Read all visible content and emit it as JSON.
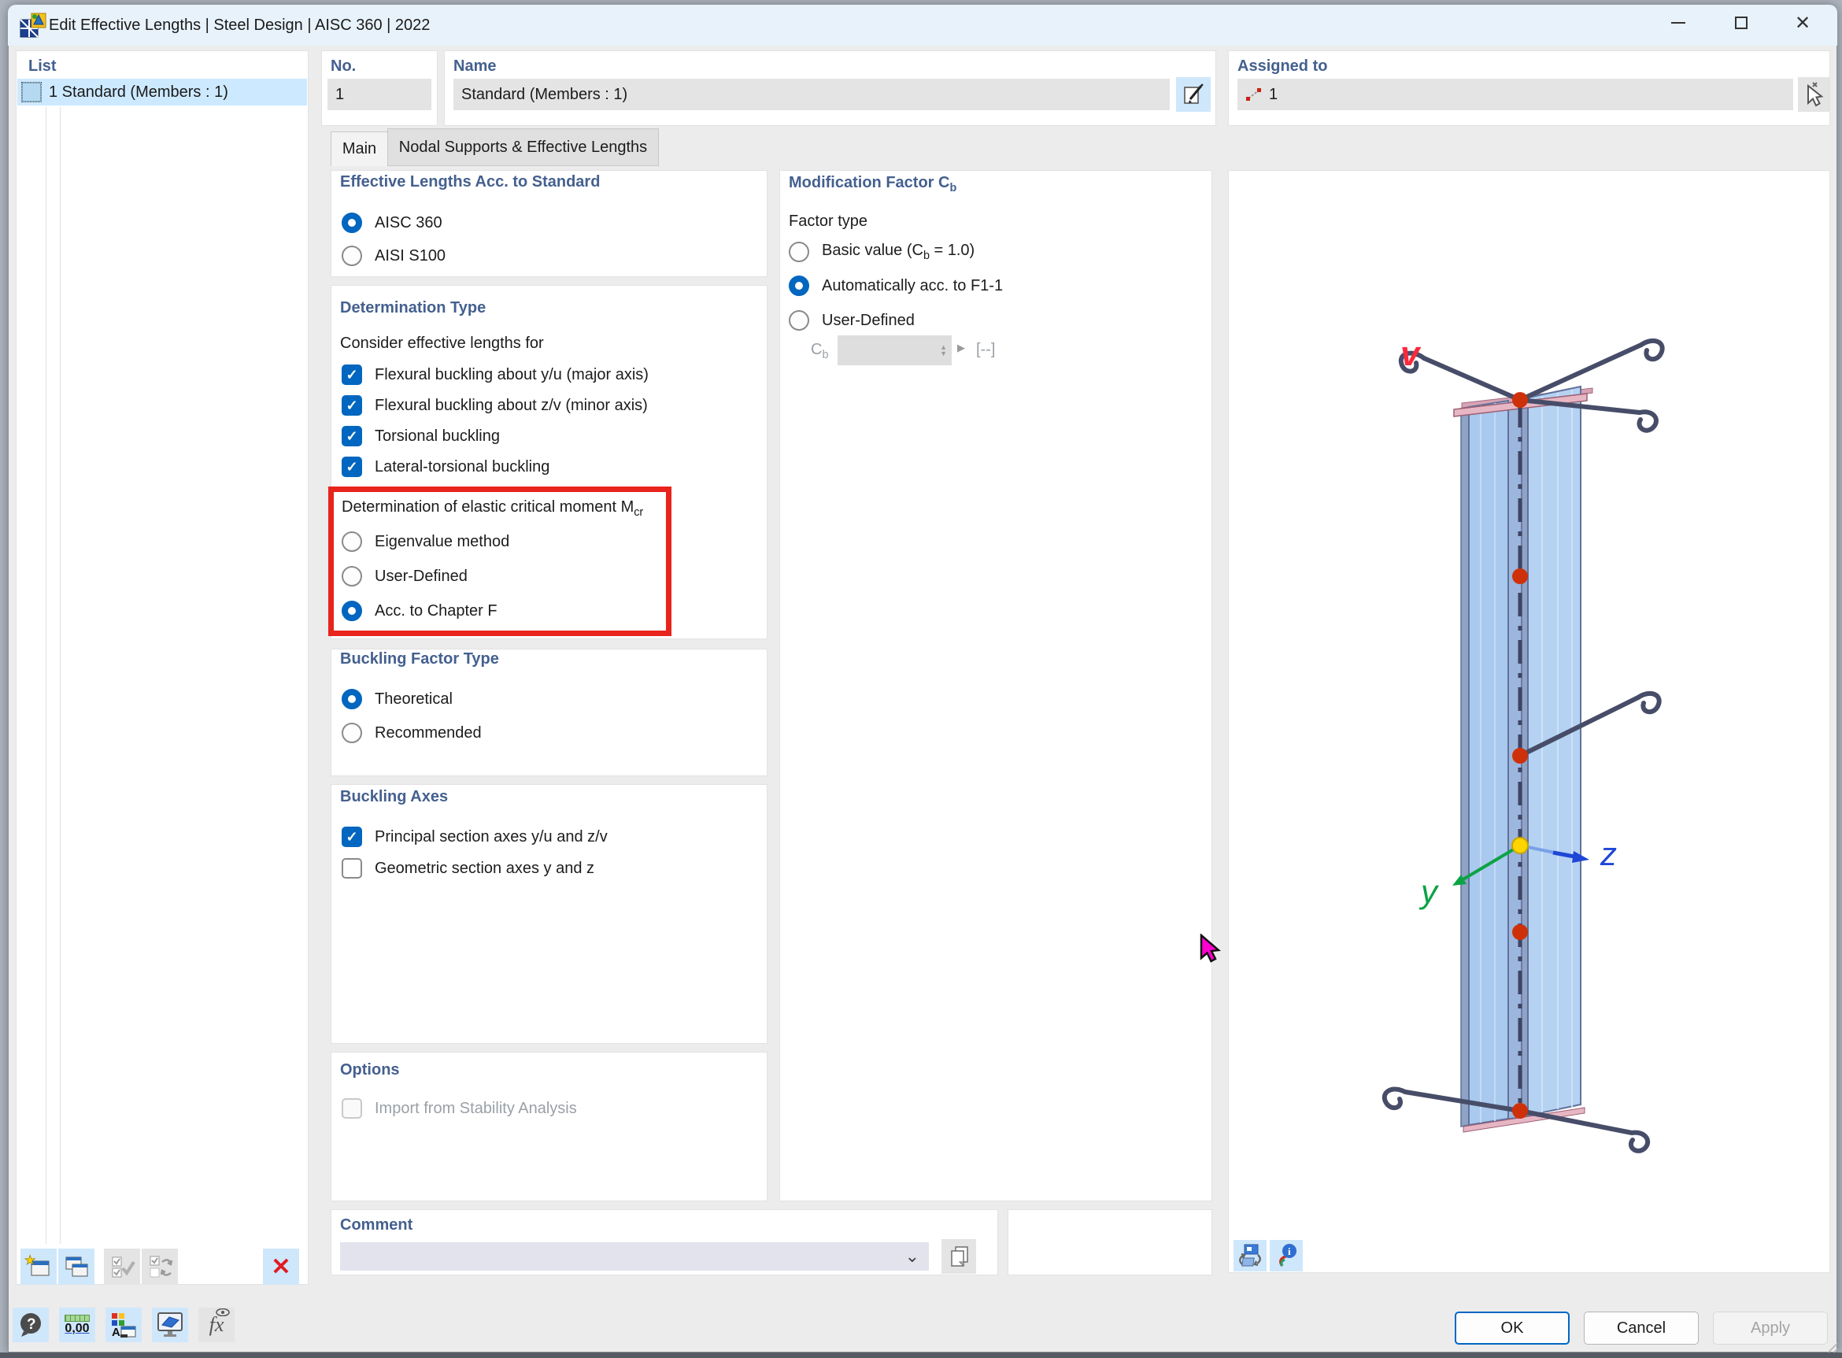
{
  "window": {
    "title": "Edit Effective Lengths | Steel Design | AISC 360 | 2022"
  },
  "list_panel": {
    "header": "List",
    "item": "1 Standard (Members : 1)"
  },
  "fields": {
    "no_label": "No.",
    "no_value": "1",
    "name_label": "Name",
    "name_value": "Standard (Members : 1)",
    "assigned_label": "Assigned to",
    "assigned_value": "1"
  },
  "tabs": {
    "main": "Main",
    "nodal": "Nodal Supports & Effective Lengths"
  },
  "std": {
    "title": "Effective Lengths Acc. to Standard",
    "options": [
      "AISC 360",
      "AISI S100"
    ],
    "selected": "AISC 360"
  },
  "det": {
    "title": "Determination Type",
    "consider": "Consider effective lengths for",
    "checks": [
      {
        "label": "Flexural buckling about y/u (major axis)",
        "checked": true
      },
      {
        "label": "Flexural buckling about z/v (minor axis)",
        "checked": true
      },
      {
        "label": "Torsional buckling",
        "checked": true
      },
      {
        "label": "Lateral-torsional buckling",
        "checked": true
      }
    ]
  },
  "mcr": {
    "label_pre": "Determination of elastic critical moment M",
    "label_sub": "cr",
    "options": [
      "Eigenvalue method",
      "User-Defined",
      "Acc. to Chapter F"
    ],
    "selected": "Acc. to Chapter F"
  },
  "bft": {
    "title": "Buckling Factor Type",
    "options": [
      "Theoretical",
      "Recommended"
    ],
    "selected": "Theoretical"
  },
  "axes": {
    "title": "Buckling Axes",
    "checks": [
      {
        "label": "Principal section axes y/u and z/v",
        "checked": true
      },
      {
        "label": "Geometric section axes y and z",
        "checked": false
      }
    ]
  },
  "opts": {
    "title": "Options",
    "check": "Import from Stability Analysis"
  },
  "cb": {
    "title_pre": "Modification Factor C",
    "title_sub": "b",
    "factor_label": "Factor type",
    "r1_pre": "Basic value (C",
    "r1_sub": "b",
    "r1_post": " = 1.0)",
    "r2": "Automatically acc. to F1-1",
    "r3": "User-Defined",
    "cb_pre": "C",
    "cb_sub": "b",
    "unit": "[--]",
    "selected": "Automatically acc. to F1-1"
  },
  "comment": {
    "title": "Comment"
  },
  "viewport": {
    "axis_v": "v",
    "axis_y": "y",
    "axis_z": "z"
  },
  "footer": {
    "ok": "OK",
    "cancel": "Cancel",
    "apply": "Apply"
  },
  "icons": {
    "check": "✓",
    "big_check": "✔",
    "chevron_down": "⌄",
    "close": "✕",
    "minimize": "—",
    "star": "★",
    "question": "?",
    "units": "0,00",
    "fx": "fx",
    "info": "i",
    "spin_up": "▲",
    "spin_down": "▼",
    "spin_right": "▶",
    "rotate": "⟳",
    "toggle_arrows": "⇄",
    "delete_x": "✕"
  },
  "colors": {
    "accent": "#0066c0",
    "highlight_red": "#e8241c",
    "section_header": "#44608f",
    "titlebar": "#e8f2fb",
    "selection": "#cde9ff"
  }
}
